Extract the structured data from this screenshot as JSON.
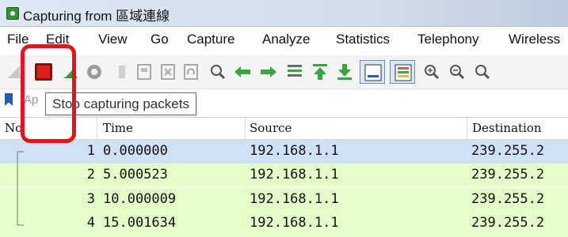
{
  "window": {
    "title": "Capturing from 區域連線"
  },
  "menu": [
    "File",
    "Edit",
    "View",
    "Go",
    "Capture",
    "Analyze",
    "Statistics",
    "Telephony",
    "Wireless"
  ],
  "toolbar": {
    "icons": [
      "shark-fin-icon",
      "stop-capture-icon",
      "restart-capture-icon",
      "capture-options-icon",
      "open-file-icon",
      "save-file-icon",
      "close-file-icon",
      "reload-file-icon",
      "find-packet-icon",
      "go-back-icon",
      "go-forward-icon",
      "go-to-packet-icon",
      "go-first-icon",
      "go-last-icon",
      "autoscroll-icon",
      "colorize-icon",
      "zoom-in-icon",
      "zoom-out-icon",
      "zoom-normal-icon"
    ],
    "accent": "#e3141b"
  },
  "filter": {
    "placeholder_visible": "Ap"
  },
  "tooltip": {
    "text": "Stop capturing packets"
  },
  "columns": [
    "No.",
    "Time",
    "Source",
    "Destination"
  ],
  "packets": [
    {
      "no": "1",
      "time": "0.000000",
      "source": "192.168.1.1",
      "destination": "239.255.2",
      "bg": "#cfe1f5"
    },
    {
      "no": "2",
      "time": "5.000523",
      "source": "192.168.1.1",
      "destination": "239.255.2",
      "bg": "#e4ffc7"
    },
    {
      "no": "3",
      "time": "10.000009",
      "source": "192.168.1.1",
      "destination": "239.255.2",
      "bg": "#e4ffc7"
    },
    {
      "no": "4",
      "time": "15.001634",
      "source": "192.168.1.1",
      "destination": "239.255.2",
      "bg": "#e4ffc7"
    }
  ]
}
